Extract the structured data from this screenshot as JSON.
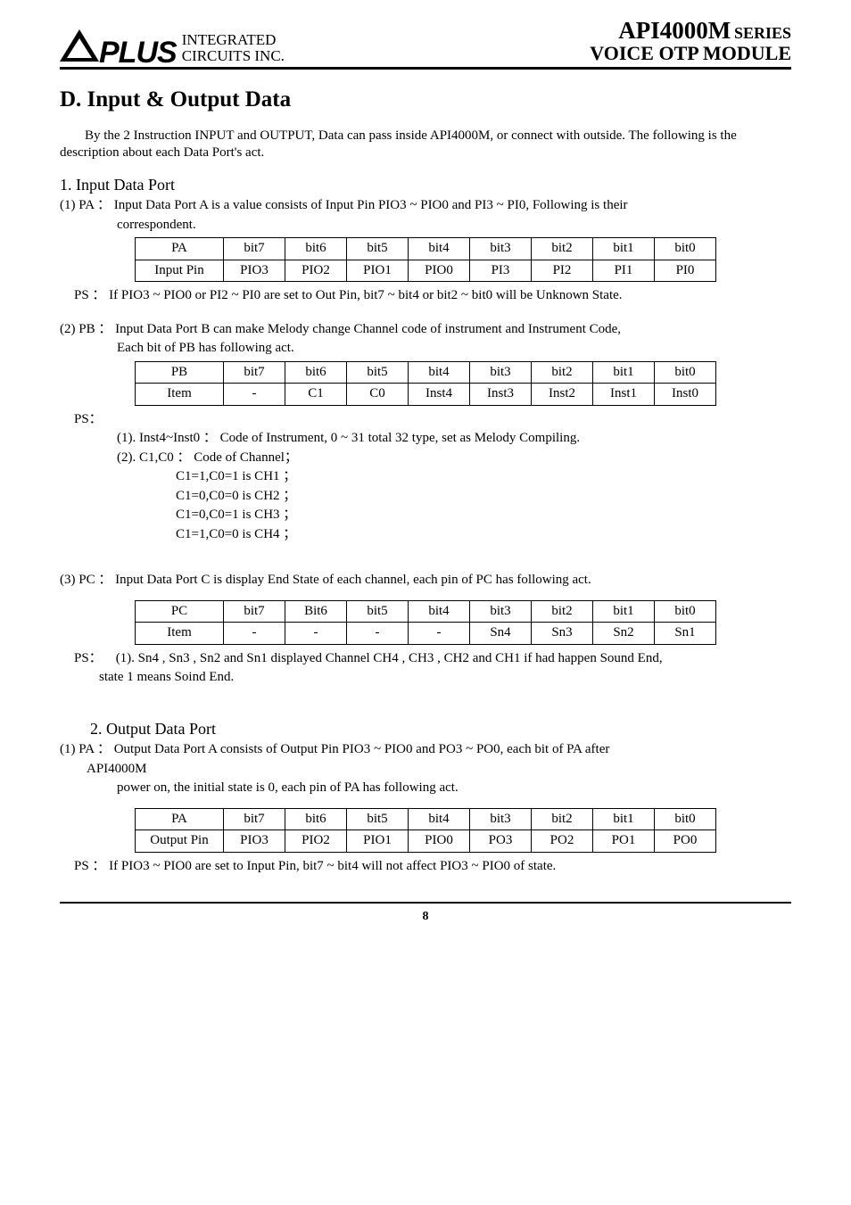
{
  "header": {
    "logo_text": "PLUS",
    "logo_sub1": "INTEGRATED",
    "logo_sub2": "CIRCUITS  INC.",
    "title_main": "API4000M",
    "title_series": "SERIES",
    "title_sub": "VOICE  OTP  MODULE"
  },
  "section": {
    "title": "D. Input & Output Data",
    "intro": "By the 2 Instruction INPUT and OUTPUT, Data can pass inside API4000M, or connect with outside. The following is the description about each Data Port's act."
  },
  "input": {
    "title": "1. Input Data Port",
    "pa_line": "(1) PA ： Input Data Port A is a value consists of Input Pin PIO3 ~ PIO0 and PI3 ~ PI0, Following is their",
    "pa_line2": "correspondent.",
    "pa_table": {
      "h": [
        "PA",
        "bit7",
        "bit6",
        "bit5",
        "bit4",
        "bit3",
        "bit2",
        "bit1",
        "bit0"
      ],
      "r": [
        "Input Pin",
        "PIO3",
        "PIO2",
        "PIO1",
        "PIO0",
        "PI3",
        "PI2",
        "PI1",
        "PI0"
      ]
    },
    "pa_ps": "PS ： If PIO3 ~ PIO0 or PI2 ~ PI0 are set to Out Pin, bit7 ~ bit4 or bit2 ~ bit0 will be Unknown State.",
    "pb_line": "(2) PB ： Input Data Port B can make Melody change Channel code of instrument and Instrument Code,",
    "pb_line2": "Each bit of PB has following act.",
    "pb_table": {
      "h": [
        "PB",
        "bit7",
        "bit6",
        "bit5",
        "bit4",
        "bit3",
        "bit2",
        "bit1",
        "bit0"
      ],
      "r": [
        "Item",
        "-",
        "C1",
        "C0",
        "Inst4",
        "Inst3",
        "Inst2",
        "Inst1",
        "Inst0"
      ]
    },
    "pb_ps_label": "PS：",
    "pb_ps1": "(1). Inst4~Inst0 ： Code of Instrument, 0 ~ 31 total 32 type, set as Melody Compiling.",
    "pb_ps2": "(2). C1,C0 ： Code of Channel；",
    "ch_lines": [
      "C1=1,C0=1 is CH1 ；",
      "C1=0,C0=0 is CH2 ；",
      "C1=0,C0=1 is CH3 ；",
      "C1=1,C0=0 is CH4 ；"
    ],
    "pc_line": "(3) PC ： Input Data Port C is display End State of each channel, each pin of PC has following act.",
    "pc_table": {
      "h": [
        "PC",
        "bit7",
        "Bit6",
        "bit5",
        "bit4",
        "bit3",
        "bit2",
        "bit1",
        "bit0"
      ],
      "r": [
        "Item",
        "-",
        "-",
        "-",
        "-",
        "Sn4",
        "Sn3",
        "Sn2",
        "Sn1"
      ]
    },
    "pc_ps_label": "PS：",
    "pc_ps1": "(1). Sn4 , Sn3 , Sn2 and Sn1 displayed Channel CH4 , CH3 , CH2 and CH1 if had happen Sound End,",
    "pc_ps2": "state 1 means Soind End."
  },
  "output": {
    "title": "2. Output Data Port",
    "pa_line1": "(1)  PA ： Output Data Port A consists of Output Pin PIO3 ~ PIO0 and PO3 ~ PO0, each bit of PA after",
    "pa_line2": "API4000M",
    "pa_line3": "power on, the initial state is 0, each pin of PA has following act.",
    "pa_table": {
      "h": [
        "PA",
        "bit7",
        "bit6",
        "bit5",
        "bit4",
        "bit3",
        "bit2",
        "bit1",
        "bit0"
      ],
      "r": [
        "Output Pin",
        "PIO3",
        "PIO2",
        "PIO1",
        "PIO0",
        "PO3",
        "PO2",
        "PO1",
        "PO0"
      ]
    },
    "pa_ps": "PS ： If PIO3 ~ PIO0 are set to Input Pin, bit7 ~ bit4 will not affect PIO3 ~ PIO0 of state."
  },
  "footer": {
    "page": "8"
  }
}
